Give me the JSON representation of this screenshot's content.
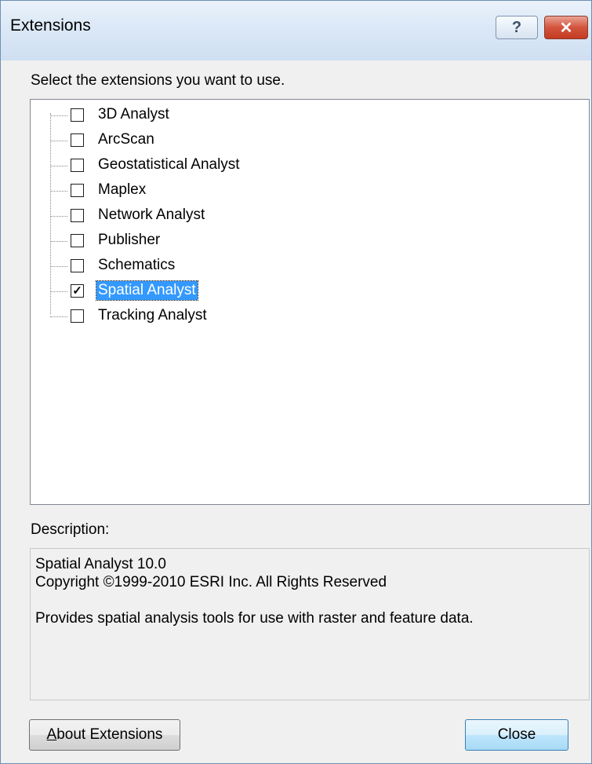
{
  "window": {
    "title": "Extensions",
    "help_glyph": "?",
    "close_glyph": "✕"
  },
  "prompt": "Select the extensions you want to use.",
  "extensions": [
    {
      "label": "3D Analyst",
      "checked": false
    },
    {
      "label": "ArcScan",
      "checked": false
    },
    {
      "label": "Geostatistical Analyst",
      "checked": false
    },
    {
      "label": "Maplex",
      "checked": false
    },
    {
      "label": "Network Analyst",
      "checked": false
    },
    {
      "label": "Publisher",
      "checked": false
    },
    {
      "label": "Schematics",
      "checked": false
    },
    {
      "label": "Spatial Analyst",
      "checked": true,
      "selected": true
    },
    {
      "label": "Tracking Analyst",
      "checked": false
    }
  ],
  "description": {
    "label": "Description:",
    "lines": [
      "Spatial Analyst 10.0",
      "Copyright ©1999-2010 ESRI Inc. All Rights Reserved",
      "",
      "Provides spatial analysis tools for use with raster and feature data."
    ]
  },
  "buttons": {
    "about_first": "A",
    "about_rest": "bout Extensions",
    "close": "Close"
  },
  "colors": {
    "selection": "#3399ff",
    "titlebar": "#dbe8f6"
  }
}
